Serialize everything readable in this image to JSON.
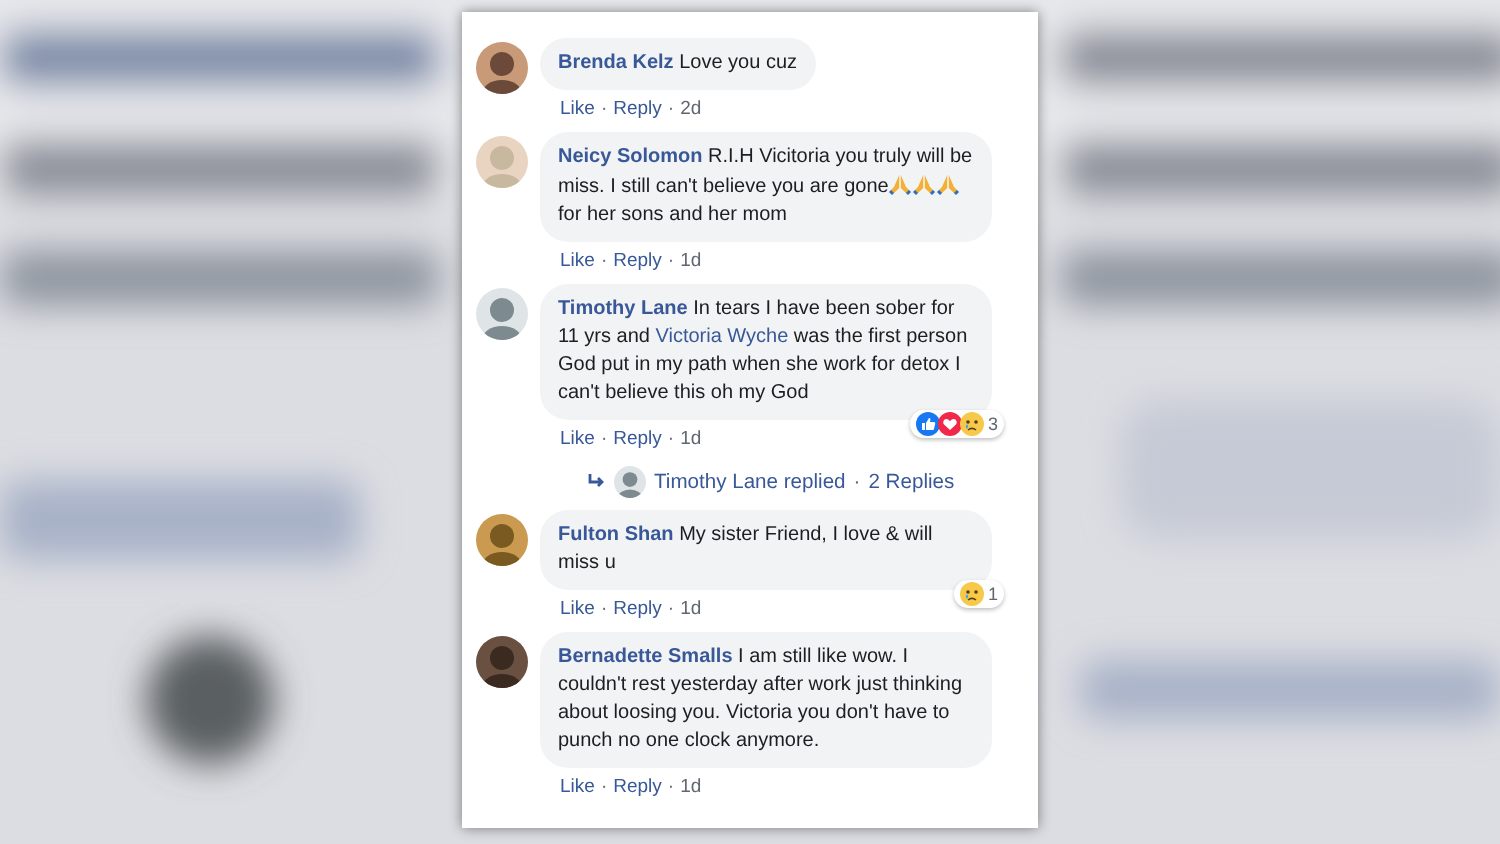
{
  "comments": [
    {
      "name": "Brenda Kelz",
      "body": [
        {
          "kind": "text",
          "text": "Love you cuz"
        }
      ],
      "actions": [
        "Like",
        "Reply"
      ],
      "separator": "·",
      "time": "2d"
    },
    {
      "name": "Neicy Solomon",
      "body": [
        {
          "kind": "text",
          "text": "R.I.H Vicitoria you truly will be miss. I still can't believe you are gone"
        },
        {
          "kind": "emoji"
        },
        {
          "kind": "emoji"
        },
        {
          "kind": "emoji"
        },
        {
          "kind": "text",
          "text": "for her sons and her mom"
        }
      ],
      "actions": [
        "Like",
        "Reply"
      ],
      "separator": "·",
      "time": "1d"
    },
    {
      "name": "Timothy Lane",
      "body": [
        {
          "kind": "text",
          "text": "In tears I have been sober for 11 yrs and "
        },
        {
          "kind": "mention",
          "text": "Victoria Wyche"
        },
        {
          "kind": "text",
          "text": " was the first person God put in my path when she work for detox I can't believe this oh my God"
        }
      ],
      "actions": [
        "Like",
        "Reply"
      ],
      "separator": "·",
      "time": "1d",
      "reactions": {
        "items": [
          {
            "kind": "like"
          },
          {
            "kind": "love"
          },
          {
            "kind": "sad"
          }
        ],
        "count": "3"
      },
      "replies": {
        "text": "Timothy Lane replied",
        "separator": "·",
        "count": "2 Replies"
      }
    },
    {
      "name": "Fulton Shan",
      "body": [
        {
          "kind": "text",
          "text": "My sister Friend, I love & will miss u"
        }
      ],
      "actions": [
        "Like",
        "Reply"
      ],
      "separator": "·",
      "time": "1d",
      "reactions": {
        "items": [
          {
            "kind": "sad"
          }
        ],
        "count": "1"
      }
    },
    {
      "name": "Bernadette Smalls",
      "body": [
        {
          "kind": "text",
          "text": "I am still like wow. I couldn't rest yesterday after work just thinking about loosing you. Victoria you don't have to punch no one clock anymore."
        }
      ],
      "actions": [
        "Like",
        "Reply"
      ],
      "separator": "·",
      "time": "1d"
    }
  ]
}
